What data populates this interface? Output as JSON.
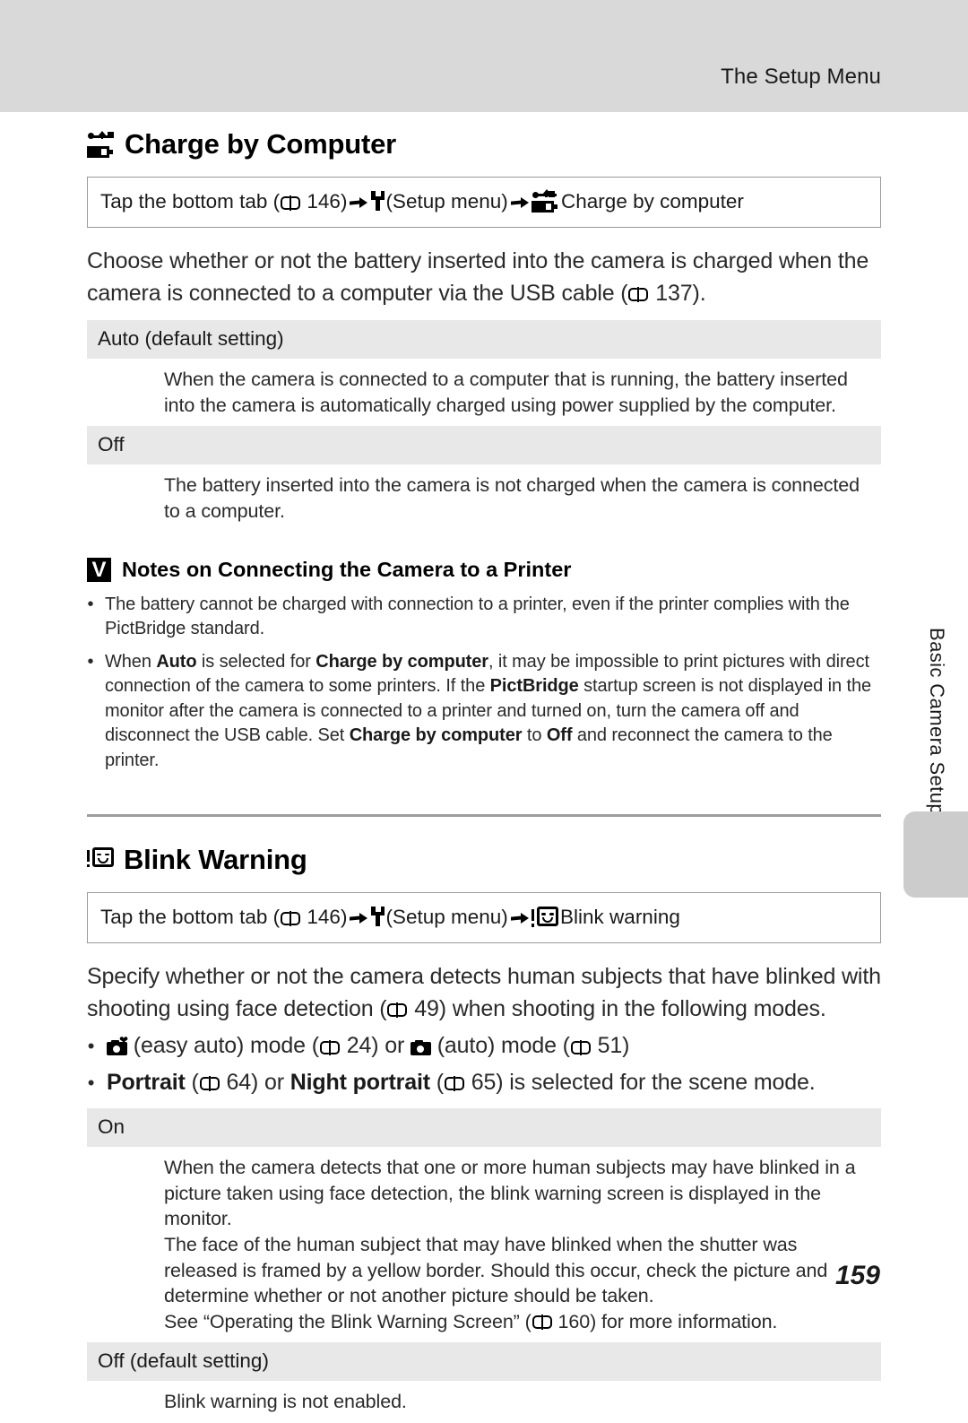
{
  "header": {
    "running_title": "The Setup Menu"
  },
  "sidebar": {
    "chapter_label": "Basic Camera Setup"
  },
  "page_number": "159",
  "sections": [
    {
      "id": "charge-by-computer",
      "icon": "usb-battery-icon",
      "heading": "Charge by Computer",
      "tap_path": {
        "prefix": "Tap the bottom tab (",
        "page_ref_1": "146",
        "mid_1": ")",
        "setup_label": "(Setup menu)",
        "target_label": "Charge by computer"
      },
      "intro": {
        "text_before_ref": "Choose whether or not the battery inserted into the camera is charged when the camera is connected to a computer via the USB cable (",
        "page_ref": "137",
        "text_after_ref": ")."
      },
      "options": [
        {
          "label": "Auto (default setting)",
          "lines": [
            "When the camera is connected to a computer that is running, the battery inserted into the camera is automatically charged using power supplied by the computer."
          ]
        },
        {
          "label": "Off",
          "lines": [
            "The battery inserted into the camera is not charged when the camera is connected to a computer."
          ]
        }
      ],
      "caution": {
        "icon": "caution-v-icon",
        "title": "Notes on Connecting the Camera to a Printer",
        "bullets": [
          {
            "parts": [
              {
                "t": "The battery cannot be charged with connection to a printer, even if the printer complies with the PictBridge standard.",
                "b": false
              }
            ]
          },
          {
            "parts": [
              {
                "t": "When ",
                "b": false
              },
              {
                "t": "Auto",
                "b": true
              },
              {
                "t": " is selected for ",
                "b": false
              },
              {
                "t": "Charge by computer",
                "b": true
              },
              {
                "t": ", it may be impossible to print pictures with direct connection of the camera to some printers. If the ",
                "b": false
              },
              {
                "t": "PictBridge",
                "b": true
              },
              {
                "t": " startup screen is not displayed in the monitor after the camera is connected to a printer and turned on, turn the camera off and disconnect the USB cable. Set ",
                "b": false
              },
              {
                "t": "Charge by computer",
                "b": true
              },
              {
                "t": " to ",
                "b": false
              },
              {
                "t": "Off",
                "b": true
              },
              {
                "t": " and reconnect the camera to the printer.",
                "b": false
              }
            ]
          }
        ]
      }
    },
    {
      "id": "blink-warning",
      "icon": "blink-face-icon",
      "heading": "Blink Warning",
      "tap_path": {
        "prefix": "Tap the bottom tab (",
        "page_ref_1": "146",
        "mid_1": ")",
        "setup_label": "(Setup menu)",
        "target_label": "Blink warning"
      },
      "intro": {
        "text_before_ref": "Specify whether or not the camera detects human subjects that have blinked with shooting using face detection (",
        "page_ref": "49",
        "text_after_ref": ") when shooting in the following modes."
      },
      "mode_bullets": [
        {
          "icons": [
            "easy-auto-camera-icon",
            "auto-camera-icon"
          ],
          "seg_1": "(easy auto) mode (",
          "ref_1": "24",
          "seg_2": ") or ",
          "seg_3": "(auto) mode (",
          "ref_2": "51",
          "seg_4": ")"
        },
        {
          "bold_1": "Portrait",
          "seg_1": " (",
          "ref_1": "64",
          "seg_2": ") or ",
          "bold_2": "Night portrait",
          "seg_3": " (",
          "ref_2": "65",
          "seg_4": ") is selected for the scene mode."
        }
      ],
      "options": [
        {
          "label": "On",
          "lines": [
            "When the camera detects that one or more human subjects may have blinked in a picture taken using face detection, the blink warning screen is displayed in the monitor.",
            "The face of the human subject that may have blinked when the shutter was released is framed by a yellow border. Should this occur, check the picture and determine whether or not another picture should be taken.",
            "See “Operating the Blink Warning Screen” ( 160) for more information."
          ],
          "last_line_ref": "160",
          "last_line_before": "See “Operating the Blink Warning Screen” (",
          "last_line_after": ") for more information."
        },
        {
          "label": "Off (default setting)",
          "lines": [
            "Blink warning is not enabled."
          ]
        }
      ]
    }
  ],
  "colors": {
    "header_band": "#d9d9d9",
    "option_row": "#e8e8e8",
    "side_tab": "#cccccc",
    "rule": "#9d9d9d"
  }
}
